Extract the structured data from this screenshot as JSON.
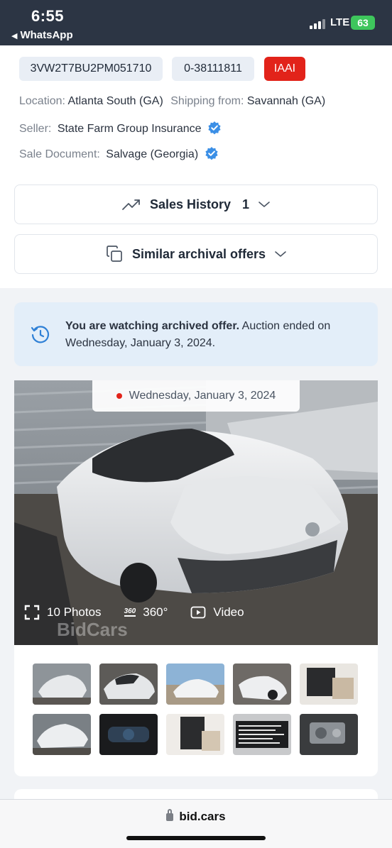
{
  "status_bar": {
    "time": "6:55",
    "back_app": "WhatsApp",
    "network": "LTE",
    "battery": "63"
  },
  "listing": {
    "vin": "3VW2T7BU2PM051710",
    "lot": "0-38111811",
    "auction": "IAAI",
    "location_label": "Location:",
    "location_value": "Atlanta South (GA)",
    "shipping_label": "Shipping from:",
    "shipping_value": "Savannah (GA)",
    "seller_label": "Seller:",
    "seller_value": "State Farm Group Insurance",
    "sale_doc_label": "Sale Document:",
    "sale_doc_value": "Salvage (Georgia)"
  },
  "accordions": {
    "sales_history_label": "Sales History",
    "sales_history_count": "1",
    "similar_offers_label": "Similar archival offers"
  },
  "banner": {
    "bold": "You are watching archived offer.",
    "rest": " Auction ended on Wednesday, January 3, 2024."
  },
  "gallery": {
    "date": "Wednesday, January 3, 2024",
    "photos_label": "10 Photos",
    "badge_360": "360",
    "view_360": "360°",
    "video": "Video",
    "watermark": "BidCars",
    "thumbnail_count": 10
  },
  "browser": {
    "url": "bid.cars"
  },
  "colors": {
    "auction_badge": "#e2231a",
    "verified_check": "#3b8fe6",
    "banner_bg": "#e3eef9",
    "status_bar_bg": "#2c3544"
  }
}
